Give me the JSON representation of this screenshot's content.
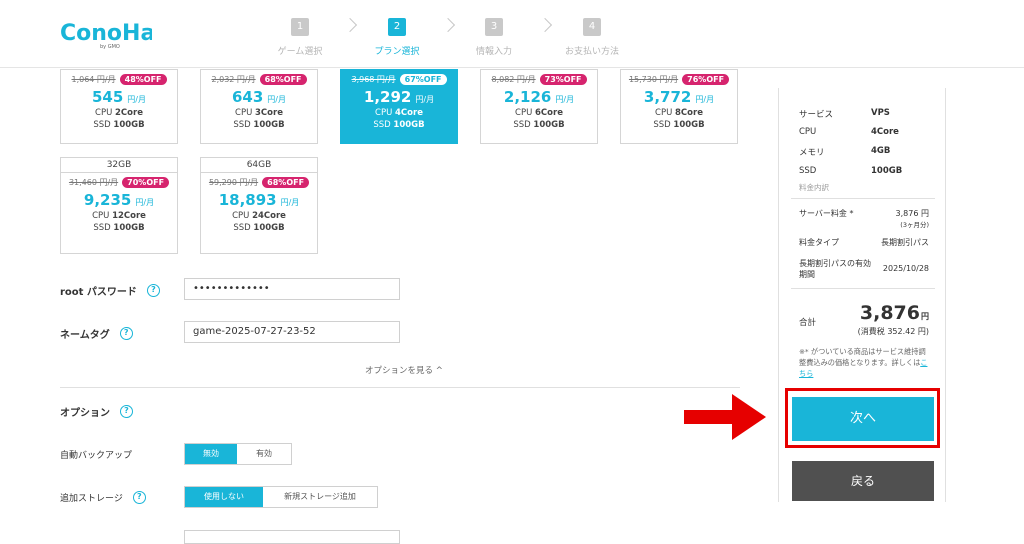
{
  "brand": {
    "logo_text": "ConoHa",
    "logo_sub": "by GMO"
  },
  "steps": [
    {
      "num": "1",
      "label": "ゲーム選択"
    },
    {
      "num": "2",
      "label": "プラン選択"
    },
    {
      "num": "3",
      "label": "情報入力"
    },
    {
      "num": "4",
      "label": "お支払い方法"
    }
  ],
  "plans": [
    {
      "old": "1,064 円/月",
      "off": "48%OFF",
      "price": "545",
      "unit": "円/月",
      "cpu_label": "CPU",
      "cpu": "2Core",
      "ssd_label": "SSD",
      "ssd": "100GB"
    },
    {
      "old": "2,032 円/月",
      "off": "68%OFF",
      "price": "643",
      "unit": "円/月",
      "cpu_label": "CPU",
      "cpu": "3Core",
      "ssd_label": "SSD",
      "ssd": "100GB"
    },
    {
      "old": "3,968 円/月",
      "off": "67%OFF",
      "price": "1,292",
      "unit": "円/月",
      "cpu_label": "CPU",
      "cpu": "4Core",
      "ssd_label": "SSD",
      "ssd": "100GB"
    },
    {
      "old": "8,082 円/月",
      "off": "73%OFF",
      "price": "2,126",
      "unit": "円/月",
      "cpu_label": "CPU",
      "cpu": "6Core",
      "ssd_label": "SSD",
      "ssd": "100GB"
    },
    {
      "old": "15,730 円/月",
      "off": "76%OFF",
      "price": "3,772",
      "unit": "円/月",
      "cpu_label": "CPU",
      "cpu": "8Core",
      "ssd_label": "SSD",
      "ssd": "100GB"
    },
    {
      "mem": "32GB",
      "old": "31,460 円/月",
      "off": "70%OFF",
      "price": "9,235",
      "unit": "円/月",
      "cpu_label": "CPU",
      "cpu": "12Core",
      "ssd_label": "SSD",
      "ssd": "100GB"
    },
    {
      "mem": "64GB",
      "old": "59,290 円/月",
      "off": "68%OFF",
      "price": "18,893",
      "unit": "円/月",
      "cpu_label": "CPU",
      "cpu": "24Core",
      "ssd_label": "SSD",
      "ssd": "100GB"
    }
  ],
  "form": {
    "root_label": "root パスワード",
    "root_value": "•••••••••••••",
    "nametag_label": "ネームタグ",
    "nametag_value": "game-2025-07-27-23-52",
    "options_toggle": "オプションを見る",
    "options_title": "オプション",
    "backup_label": "自動バックアップ",
    "backup_opts": [
      "無効",
      "有効"
    ],
    "storage_label": "追加ストレージ",
    "storage_opts": [
      "使用しない",
      "新規ストレージ追加"
    ]
  },
  "summary": {
    "rows": [
      {
        "k": "サービス",
        "v": "VPS"
      },
      {
        "k": "CPU",
        "v": "4Core"
      },
      {
        "k": "メモリ",
        "v": "4GB"
      },
      {
        "k": "SSD",
        "v": "100GB"
      }
    ],
    "breakdown_label": "料金内訳",
    "server_fee_label": "サーバー料金 *",
    "server_fee_value": "3,876 円",
    "server_fee_period": "(3ヶ月分)",
    "fee_type_label": "料金タイプ",
    "fee_type_value": "長期割引パス",
    "expiry_label": "長期割引パスの有効期間",
    "expiry_value": "2025/10/28",
    "total_label": "合計",
    "total_value": "3,876",
    "total_unit": "円",
    "tax": "(消費税 352.42 円)",
    "note": "※* がついている商品はサービス維持調整費込みの価格となります。詳しくは",
    "note_link": "こちら",
    "next_button": "次へ",
    "back_button": "戻る"
  },
  "colors": {
    "accent": "#19b5d8",
    "discount": "#d6246e",
    "highlight": "#e60000",
    "back": "#505050"
  }
}
